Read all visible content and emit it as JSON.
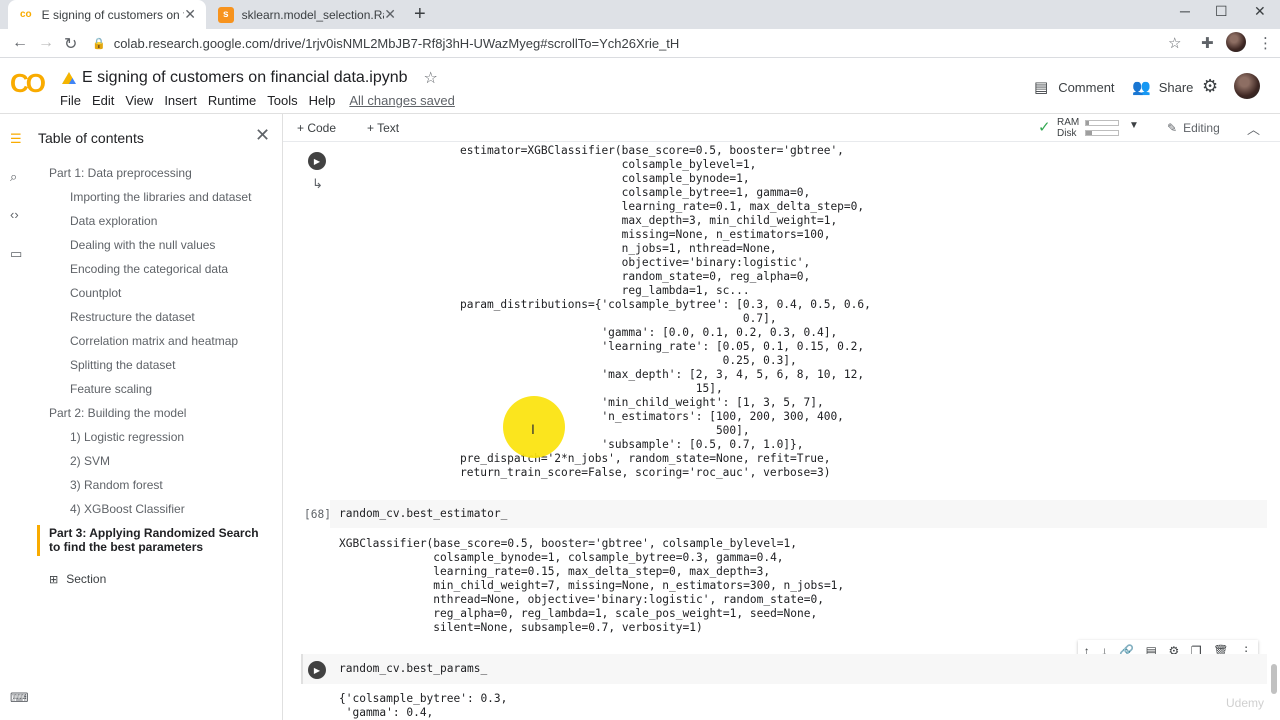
{
  "browser": {
    "tabs": [
      {
        "title": "E signing of customers on financial",
        "active": true
      },
      {
        "title": "sklearn.model_selection.Randomiz",
        "active": false
      }
    ],
    "url": "colab.research.google.com/drive/1rjv0isNML2MbJB7-Rf8j3hH-UWazMyeg#scrollTo=Ych26Xrie_tH"
  },
  "colab": {
    "logo": "CO",
    "notebook_title": "E signing of customers on financial data.ipynb",
    "menu": [
      "File",
      "Edit",
      "View",
      "Insert",
      "Runtime",
      "Tools",
      "Help"
    ],
    "save_status": "All changes saved",
    "comment_label": "Comment",
    "share_label": "Share",
    "add_code": "+ Code",
    "add_text": "+ Text",
    "ram_label": "RAM",
    "disk_label": "Disk",
    "ram_usage": 0.1,
    "disk_usage": 0.2,
    "editing_label": "Editing"
  },
  "sidebar": {
    "title": "Table of contents",
    "items": [
      {
        "label": "Part 1: Data preprocessing",
        "level": 1
      },
      {
        "label": "Importing the libraries and dataset",
        "level": 2
      },
      {
        "label": "Data exploration",
        "level": 2
      },
      {
        "label": "Dealing with the null values",
        "level": 2
      },
      {
        "label": "Encoding the categorical data",
        "level": 2
      },
      {
        "label": "Countplot",
        "level": 2
      },
      {
        "label": "Restructure the dataset",
        "level": 2
      },
      {
        "label": "Correlation matrix and heatmap",
        "level": 2
      },
      {
        "label": "Splitting the dataset",
        "level": 2
      },
      {
        "label": "Feature scaling",
        "level": 2
      },
      {
        "label": "Part 2: Building the model",
        "level": 1
      },
      {
        "label": "1) Logistic regression",
        "level": 2
      },
      {
        "label": "2) SVM",
        "level": 2
      },
      {
        "label": "3) Random forest",
        "level": 2
      },
      {
        "label": "4) XGBoost Classifier",
        "level": 2
      },
      {
        "label": "Part 3: Applying Randomized Search to find the best parameters",
        "level": 1,
        "active": true
      }
    ],
    "section_label": "Section"
  },
  "cells": {
    "output_1": "estimator=XGBClassifier(base_score=0.5, booster='gbtree',\n                        colsample_bylevel=1,\n                        colsample_bynode=1,\n                        colsample_bytree=1, gamma=0,\n                        learning_rate=0.1, max_delta_step=0,\n                        max_depth=3, min_child_weight=1,\n                        missing=None, n_estimators=100,\n                        n_jobs=1, nthread=None,\n                        objective='binary:logistic',\n                        random_state=0, reg_alpha=0,\n                        reg_lambda=1, sc...\nparam_distributions={'colsample_bytree': [0.3, 0.4, 0.5, 0.6,\n                                          0.7],\n                     'gamma': [0.0, 0.1, 0.2, 0.3, 0.4],\n                     'learning_rate': [0.05, 0.1, 0.15, 0.2,\n                                       0.25, 0.3],\n                     'max_depth': [2, 3, 4, 5, 6, 8, 10, 12,\n                                   15],\n                     'min_child_weight': [1, 3, 5, 7],\n                     'n_estimators': [100, 200, 300, 400,\n                                      500],\n                     'subsample': [0.5, 0.7, 1.0]},\npre_dispatch='2*n_jobs', random_state=None, refit=True,\nreturn_train_score=False, scoring='roc_auc', verbose=3)",
    "cell_68_count": "[68]",
    "cell_68_code": "random_cv.best_estimator_",
    "cell_68_output": "XGBClassifier(base_score=0.5, booster='gbtree', colsample_bylevel=1,\n              colsample_bynode=1, colsample_bytree=0.3, gamma=0.4,\n              learning_rate=0.15, max_delta_step=0, max_depth=3,\n              min_child_weight=7, missing=None, n_estimators=300, n_jobs=1,\n              nthread=None, objective='binary:logistic', random_state=0,\n              reg_alpha=0, reg_lambda=1, scale_pos_weight=1, seed=None,\n              silent=None, subsample=0.7, verbosity=1)",
    "cell_69_code": "random_cv.best_params_",
    "cell_69_output": "{'colsample_bytree': 0.3,\n 'gamma': 0.4,"
  },
  "watermark": "Udemy"
}
